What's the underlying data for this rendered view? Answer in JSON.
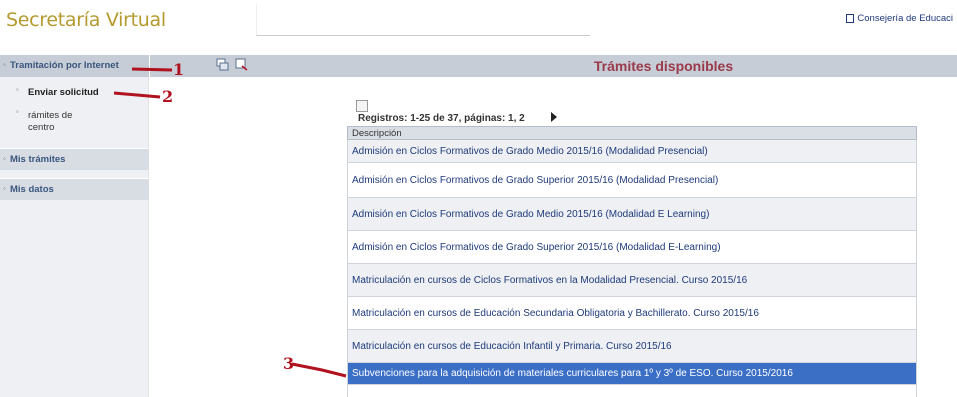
{
  "header": {
    "brand": "Secretaría Virtual",
    "consejeria": "Consejería de Educaci"
  },
  "sidebar": {
    "section_title": "Tramitación por Internet",
    "sub_items": [
      {
        "label": "Enviar solicitud"
      },
      {
        "label": "rámites de centro"
      }
    ],
    "items": [
      {
        "label": "Mis trámites"
      },
      {
        "label": "Mis datos"
      }
    ]
  },
  "toolbar": {
    "title": "Trámites disponibles"
  },
  "records": {
    "text": "Registros: 1-25 de 37, páginas: 1, 2"
  },
  "table": {
    "header": "Descripción",
    "rows": [
      "Admisión en Ciclos Formativos de Grado Medio 2015/16 (Modalidad Presencial)",
      "Admisión en Ciclos Formativos de Grado Superior 2015/16 (Modalidad Presencial)",
      "Admisión en Ciclos Formativos de Grado Medio 2015/16 (Modalidad E Learning)",
      "Admisión en Ciclos Formativos de Grado Superior 2015/16 (Modalidad E-Learning)",
      "Matriculación en cursos de Ciclos Formativos en la Modalidad Presencial. Curso 2015/16",
      "Matriculación en cursos de Educación Secundaria Obligatoria y Bachillerato. Curso 2015/16",
      "Matriculación en cursos de Educación Infantil y Primaria. Curso 2015/16",
      "Subvenciones para la adquisición de materiales curriculares para 1º y 3º de ESO. Curso 2015/2016"
    ]
  },
  "annotations": {
    "m1": "1",
    "m2": "2",
    "m3": "3"
  },
  "colors": {
    "brand": "#b49a2f",
    "title": "#9b3a4a",
    "link": "#1f3a7a",
    "selected": "#3b6fc6",
    "annotation": "#b0121f"
  }
}
